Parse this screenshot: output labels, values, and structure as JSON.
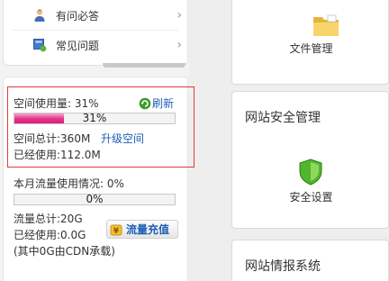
{
  "menu": {
    "items": [
      {
        "label": "有问必答",
        "icon": "user-question-icon"
      },
      {
        "label": "常见问题",
        "icon": "faq-icon"
      }
    ]
  },
  "space": {
    "usage_label": "空间使用量: 31%",
    "refresh_label": "刷新",
    "progress_percent": 31,
    "progress_text": "31%",
    "total_text": "空间总计:360M",
    "upgrade_label": "升级空间",
    "used_text": "已经使用:112.0M"
  },
  "traffic": {
    "usage_label": "本月流量使用情况: 0%",
    "progress_percent": 0,
    "progress_text": "0%",
    "total_text": "流量总计:20G",
    "used_text": "已经使用:0.0G",
    "note_text": "(其中0G由CDN承载)",
    "recharge_label": "流量充值"
  },
  "right": {
    "file_manage_label": "文件管理",
    "security_title": "网站安全管理",
    "security_setting_label": "安全设置",
    "intel_title": "网站情报系统"
  },
  "colors": {
    "accent_blue": "#1d5fb5",
    "progress_pink": "#e6308a",
    "highlight_red": "#e53a3a",
    "refresh_green": "#3a9a2a",
    "shield_green": "#52b52e",
    "folder_yellow": "#f2c84b"
  }
}
